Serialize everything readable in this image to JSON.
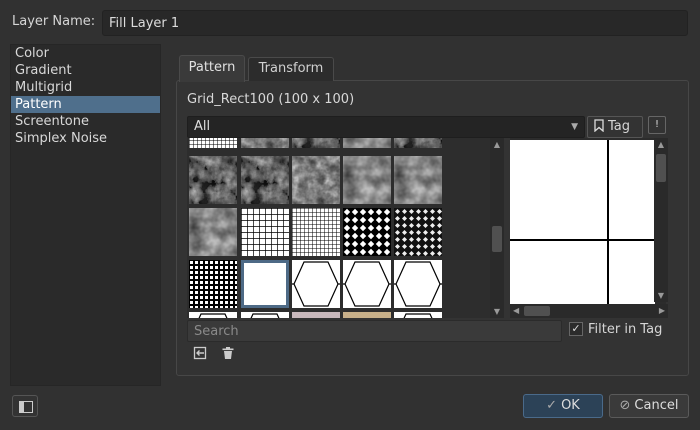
{
  "header": {
    "label": "Layer Name:",
    "layer_name": "Fill Layer 1"
  },
  "sidebar": {
    "items": [
      {
        "label": "Color"
      },
      {
        "label": "Gradient"
      },
      {
        "label": "Multigrid"
      },
      {
        "label": "Pattern",
        "selected": true
      },
      {
        "label": "Screentone"
      },
      {
        "label": "Simplex Noise"
      }
    ]
  },
  "tabs": {
    "pattern": "Pattern",
    "transform": "Transform"
  },
  "pattern": {
    "name": "Grid_Rect100 (100 x 100)",
    "tag_filter": "All",
    "tag_button": "Tag",
    "info_button": "!",
    "search_placeholder": "Search",
    "filter_in_tag": "Filter in Tag",
    "filter_checked": true
  },
  "icons": {
    "import": "import-icon",
    "delete": "trash-icon",
    "tag": "bookmark-icon"
  },
  "buttons": {
    "ok": "OK",
    "cancel": "Cancel"
  },
  "colors": {
    "accent": "#4f6f8c",
    "background": "#313131"
  }
}
